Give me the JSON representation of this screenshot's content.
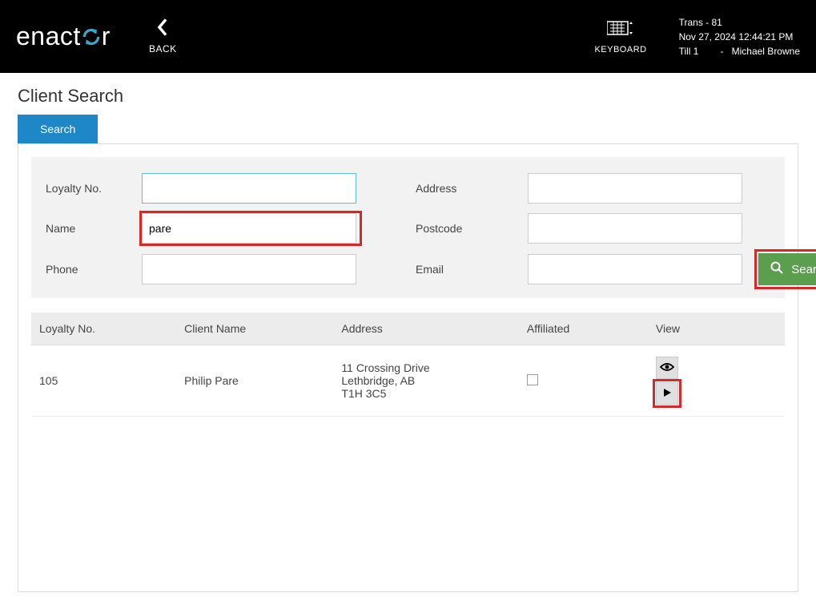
{
  "header": {
    "logo_text_pre": "enact",
    "logo_text_post": "r",
    "back_label": "BACK",
    "keyboard_label": "KEYBOARD",
    "trans_label": "Trans - 81",
    "datetime": "Nov 27, 2024 12:44:21 PM",
    "till_label": "Till 1",
    "separator": "-",
    "user_name": "Michael Browne"
  },
  "page": {
    "title": "Client Search",
    "tab_label": "Search"
  },
  "form": {
    "loyalty_label": "Loyalty No.",
    "name_label": "Name",
    "phone_label": "Phone",
    "address_label": "Address",
    "postcode_label": "Postcode",
    "email_label": "Email",
    "loyalty_value": "",
    "name_value": "pare",
    "phone_value": "",
    "address_value": "",
    "postcode_value": "",
    "email_value": "",
    "search_button": "Search"
  },
  "table": {
    "headers": {
      "loyalty": "Loyalty No.",
      "client_name": "Client Name",
      "address": "Address",
      "affiliated": "Affiliated",
      "view": "View"
    },
    "rows": [
      {
        "loyalty": "105",
        "client_name": "Philip Pare",
        "address_line1": "11 Crossing Drive",
        "address_line2": "Lethbridge, AB",
        "address_line3": "T1H 3C5",
        "affiliated": false
      }
    ]
  }
}
